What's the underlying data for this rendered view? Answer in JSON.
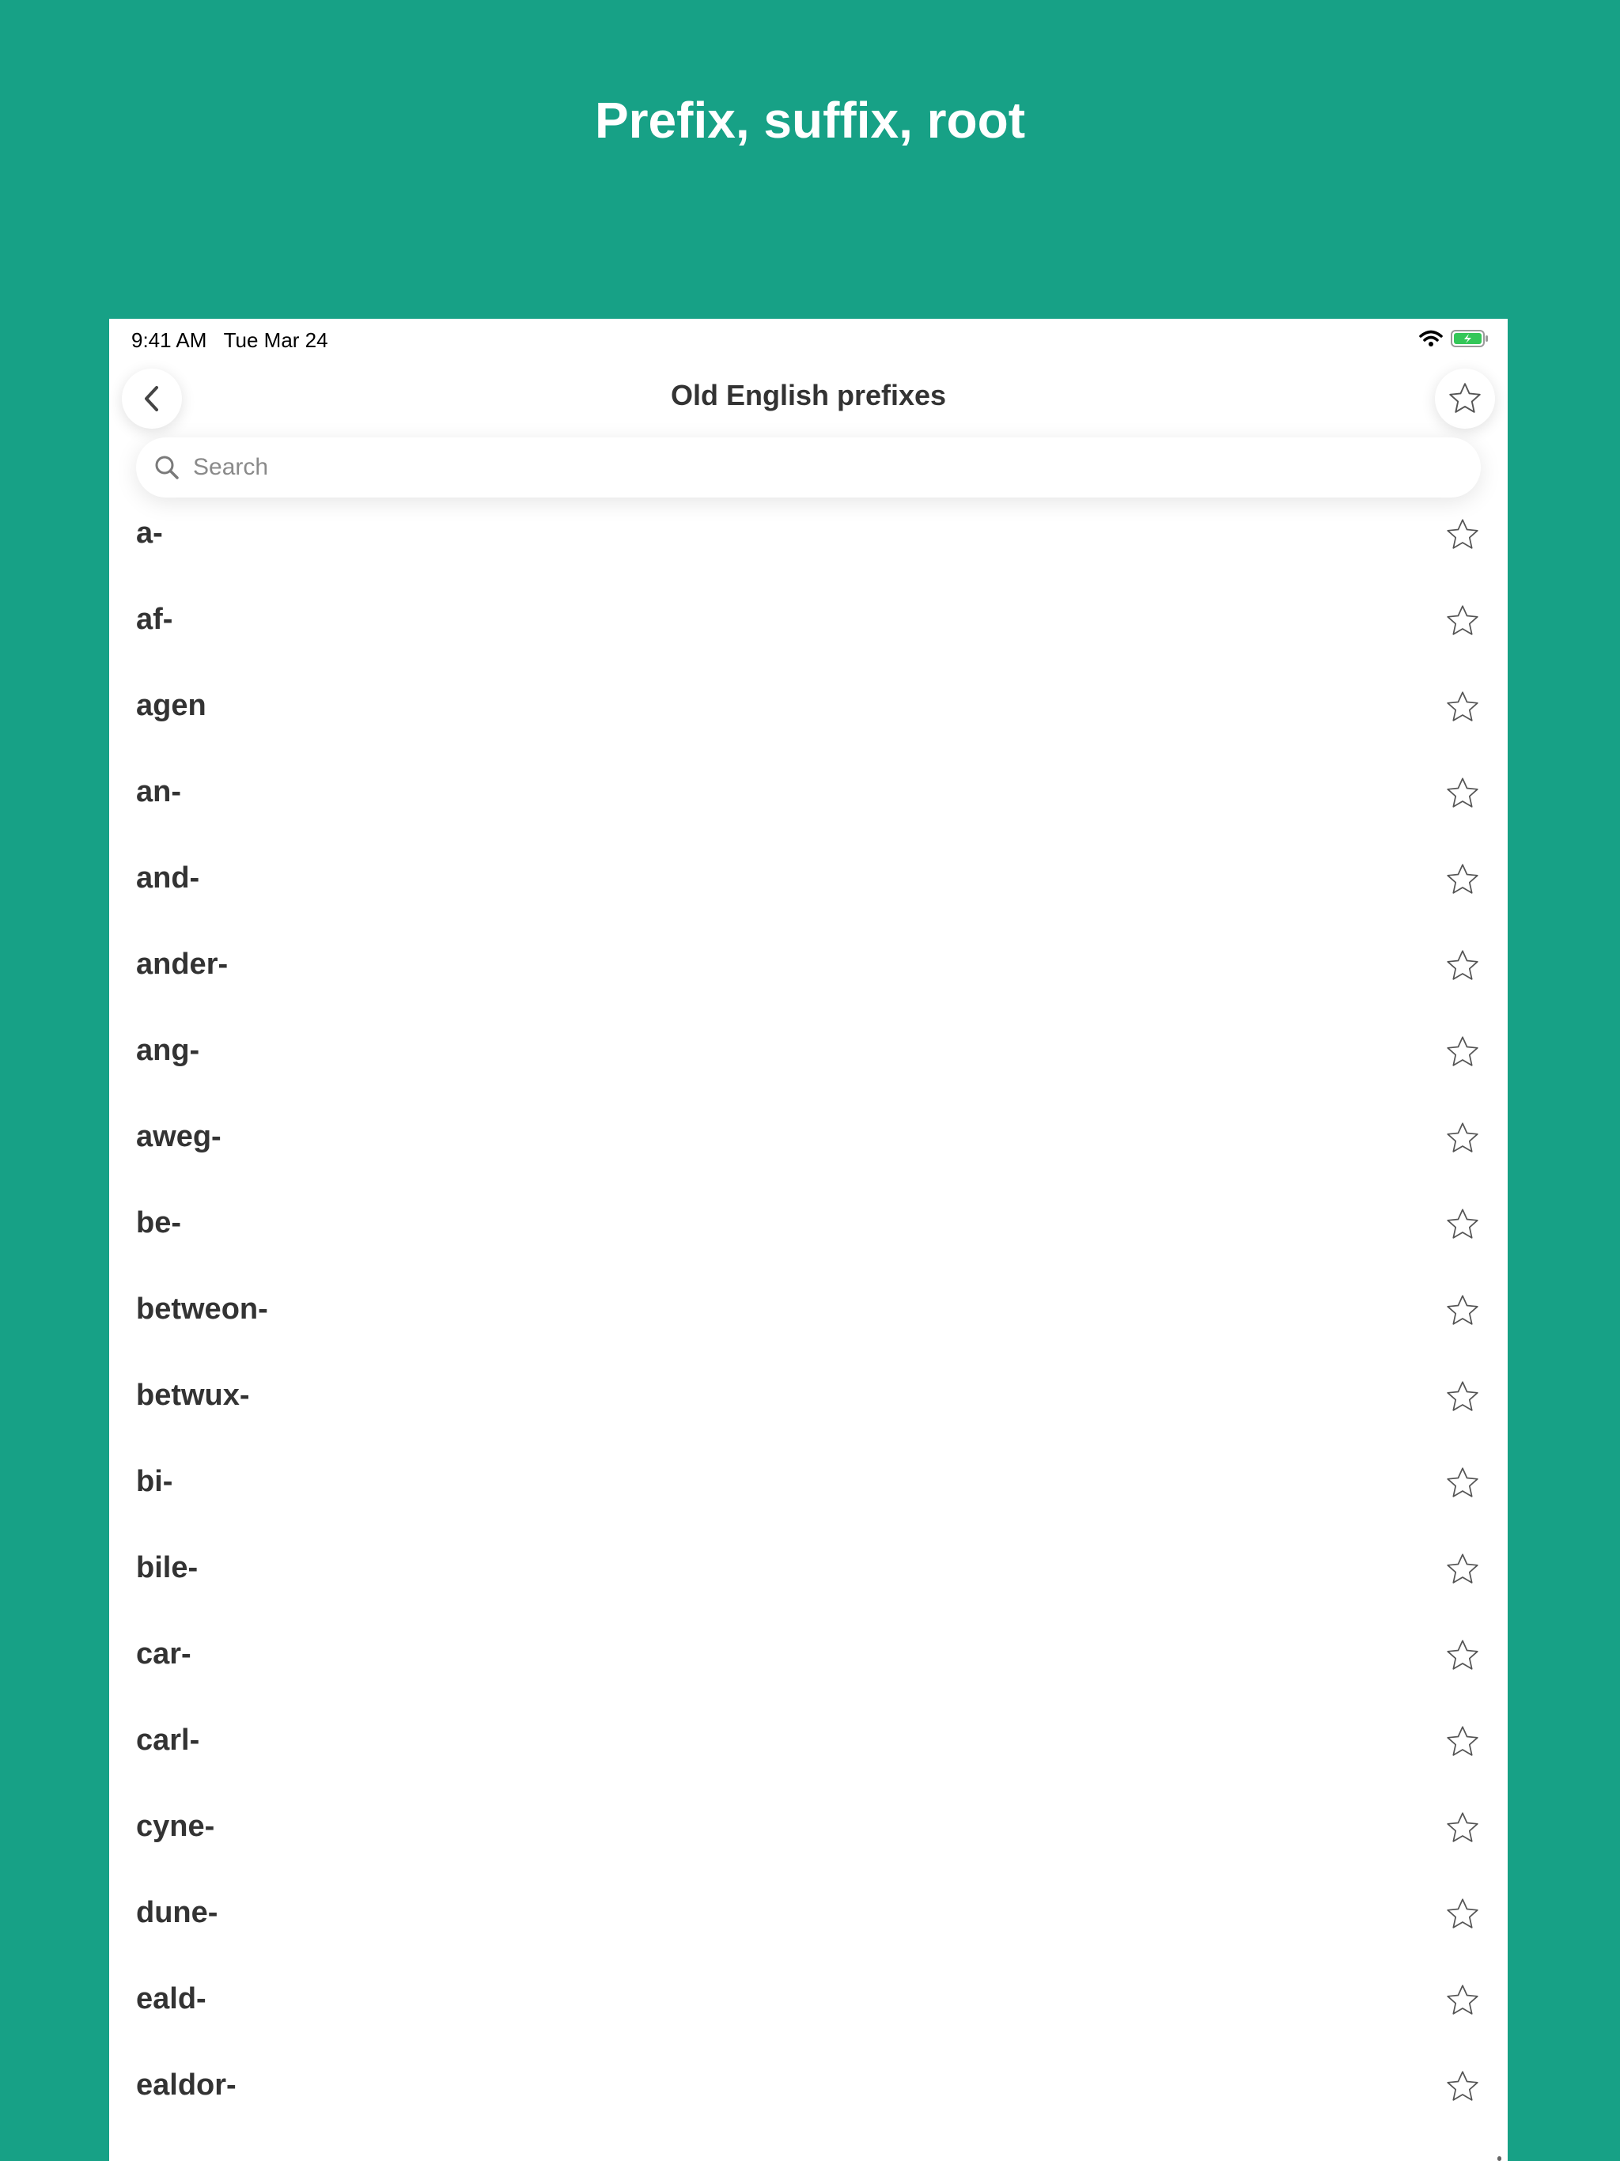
{
  "promo": {
    "title": "Prefix, suffix, root"
  },
  "status_bar": {
    "time": "9:41 AM   Tue Mar 24"
  },
  "nav": {
    "title": "Old English prefixes"
  },
  "search": {
    "placeholder": "Search"
  },
  "items": [
    {
      "label": "a-"
    },
    {
      "label": "af-"
    },
    {
      "label": "agen"
    },
    {
      "label": "an-"
    },
    {
      "label": "and-"
    },
    {
      "label": "ander-"
    },
    {
      "label": "ang-"
    },
    {
      "label": "aweg-"
    },
    {
      "label": "be-"
    },
    {
      "label": "betweon-"
    },
    {
      "label": "betwux-"
    },
    {
      "label": "bi-"
    },
    {
      "label": "bile-"
    },
    {
      "label": "car-"
    },
    {
      "label": "carl-"
    },
    {
      "label": "cyne-"
    },
    {
      "label": "dune-"
    },
    {
      "label": "eald-"
    },
    {
      "label": "ealdor-"
    }
  ],
  "colors": {
    "background": "#17a186",
    "battery": "#34c759"
  }
}
